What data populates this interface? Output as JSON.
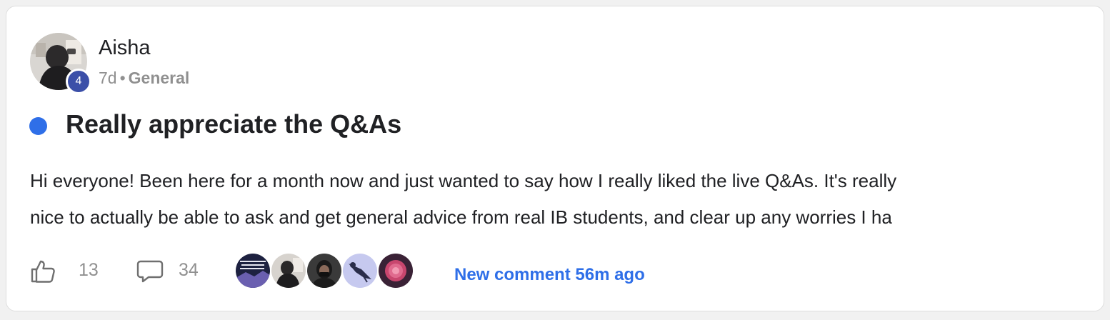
{
  "post": {
    "author": {
      "name": "Aisha",
      "level": "4",
      "avatar": "user-avatar-photo"
    },
    "meta": {
      "age": "7d",
      "separator": "•",
      "category": "General"
    },
    "unread_indicator_color": "#2f6fe8",
    "title": "Really appreciate the Q&As",
    "body_lines": [
      "Hi everyone! Been here for a month now and just wanted to say how I really liked the live Q&As. It's really",
      "nice to actually be able to ask and get general advice from real IB students, and clear up any worries I ha"
    ]
  },
  "actions": {
    "like_icon": "thumbs-up-icon",
    "like_count": "13",
    "comment_icon": "comment-bubble-icon",
    "comment_count": "34",
    "recent_commenters": [
      "commenter-avatar-1",
      "commenter-avatar-2",
      "commenter-avatar-3",
      "commenter-avatar-4",
      "commenter-avatar-5"
    ],
    "new_comment_text": "New comment 56m ago"
  },
  "colors": {
    "accent": "#2f6fe8",
    "level_badge": "#3b4fa8",
    "muted_text": "#909090",
    "text": "#202124"
  }
}
